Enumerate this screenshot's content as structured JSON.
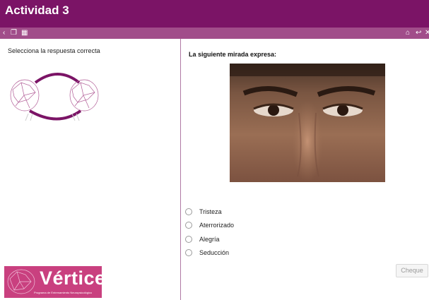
{
  "header": {
    "title": "Actividad 3"
  },
  "toolbar": {
    "left_icons": [
      "chevron-left-icon",
      "window-icon",
      "calendar-icon"
    ],
    "right_icons": [
      "home-icon",
      "reply-icon",
      "close-icon"
    ]
  },
  "left_panel": {
    "instruction": "Selecciona la respuesta correcta",
    "brand_name": "Vértice",
    "brand_subtitle": "Programa de Entrenamiento Neuropsicológico"
  },
  "question": {
    "prompt": "La siguiente mirada expresa:",
    "options": [
      "Tristeza",
      "Aterrorizado",
      "Alegría",
      "Seducción"
    ],
    "submit_label": "Cheque"
  },
  "colors": {
    "header_bg": "#7b1466",
    "toolbar_bg": "#a14d8a",
    "brand_bg": "#c9407f"
  }
}
